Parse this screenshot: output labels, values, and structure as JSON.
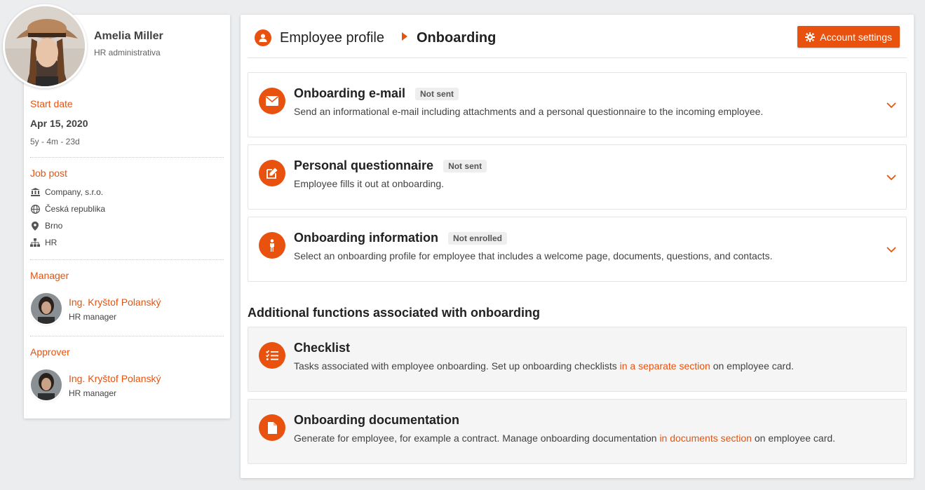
{
  "employee": {
    "name": "Amelia Miller",
    "role": "HR administrativa"
  },
  "start": {
    "label": "Start date",
    "date": "Apr 15, 2020",
    "tenure": "5y - 4m - 23d"
  },
  "job": {
    "label": "Job post",
    "company": "Company, s.r.o.",
    "country": "Česká republika",
    "city": "Brno",
    "department": "HR"
  },
  "manager": {
    "label": "Manager",
    "name": "Ing. Kryštof Polanský",
    "role": "HR manager"
  },
  "approver": {
    "label": "Approver",
    "name": "Ing. Kryštof Polanský",
    "role": "HR manager"
  },
  "header": {
    "crumb_parent": "Employee profile",
    "crumb_current": "Onboarding",
    "settings_label": "Account settings"
  },
  "panels": [
    {
      "title": "Onboarding e-mail",
      "badge": "Not sent",
      "desc": "Send an informational e-mail including attachments and a personal questionnaire to the incoming employee.",
      "icon": "envelope-icon"
    },
    {
      "title": "Personal questionnaire",
      "badge": "Not sent",
      "desc": "Employee fills it out at onboarding.",
      "icon": "edit-icon"
    },
    {
      "title": "Onboarding information",
      "badge": "Not enrolled",
      "desc": "Select an onboarding profile for employee that includes a welcome page, documents, questions, and contacts.",
      "icon": "person-icon"
    }
  ],
  "additional": {
    "title": "Additional functions associated with onboarding",
    "checklist": {
      "title": "Checklist",
      "desc_before": "Tasks associated with employee onboarding. Set up onboarding checklists ",
      "link": "in a separate section",
      "desc_after": " on employee card.",
      "icon": "checklist-icon"
    },
    "documentation": {
      "title": "Onboarding documentation",
      "desc_before": "Generate for employee, for example a contract. Manage onboarding documentation ",
      "link": "in documents section",
      "desc_after": " on employee card.",
      "icon": "document-icon"
    }
  },
  "colors": {
    "accent": "#e8520e",
    "background": "#ecedef"
  }
}
